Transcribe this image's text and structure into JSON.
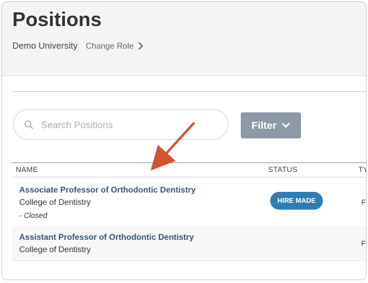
{
  "header": {
    "title": "Positions",
    "org_name": "Demo University",
    "change_role": "Change Role"
  },
  "search": {
    "placeholder": "Search Positions",
    "value": ""
  },
  "filter": {
    "label": "Filter"
  },
  "table": {
    "columns": [
      "NAME",
      "STATUS",
      "TY"
    ],
    "rows": [
      {
        "title": "Associate Professor of Orthodontic Dentistry",
        "college": "College of Dentistry",
        "note": "- Closed",
        "status": "HIRE MADE",
        "type": "Fa"
      },
      {
        "title": "Assistant Professor of Orthodontic Dentistry",
        "college": "College of Dentistry",
        "type": "Fa"
      }
    ]
  },
  "colors": {
    "header_bg": "#f4f4f5",
    "link": "#3b5476",
    "filter_bg": "#8d99a6",
    "badge_bg": "#2c7fb6",
    "arrow": "#d0552f"
  },
  "icons": [
    "chevron-right-icon",
    "search-icon",
    "chevron-down-icon",
    "annotation-arrow"
  ]
}
